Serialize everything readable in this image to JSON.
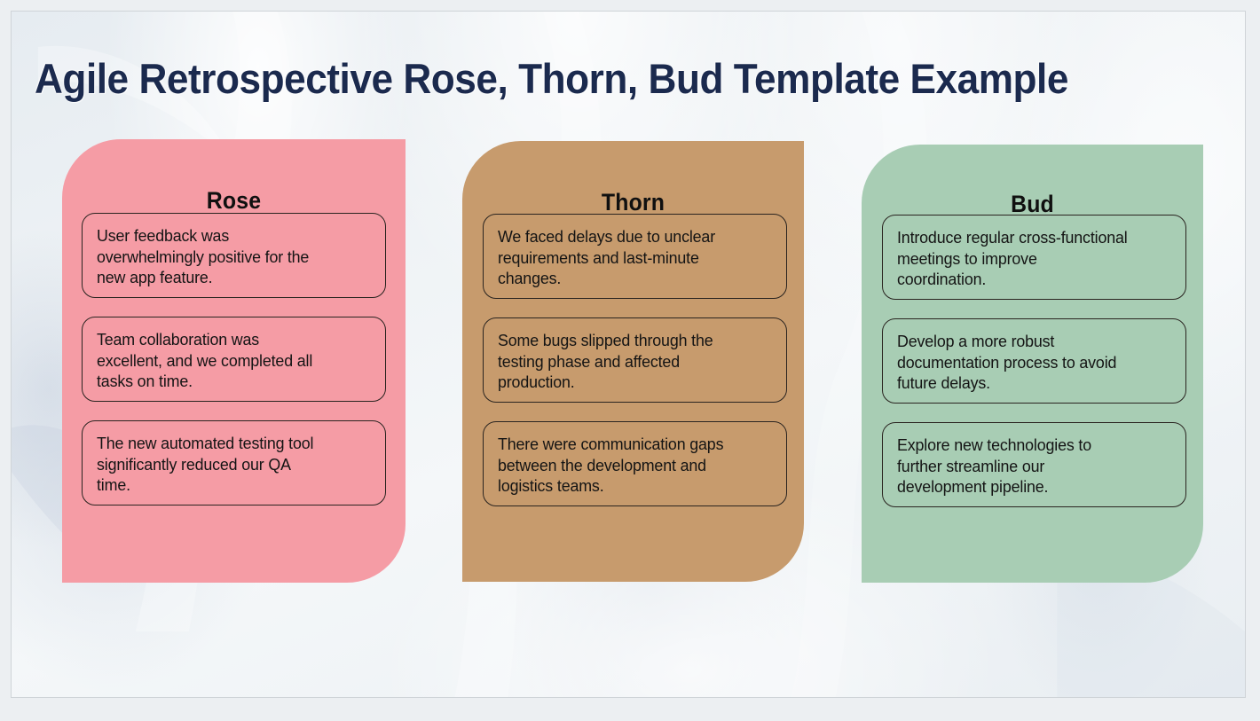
{
  "slide": {
    "title": "Agile Retrospective Rose, Thorn, Bud Template Example",
    "title_color": "#1b2a4e",
    "background_color": "#eaeff3"
  },
  "columns": [
    {
      "key": "rose",
      "title": "Rose",
      "panel_color": "#f59ca5",
      "card_border_color": "#2a2420",
      "cards": [
        {
          "text": "User feedback was\noverwhelmingly positive for the\nnew app feature."
        },
        {
          "text": "Team collaboration was\nexcellent, and we completed all\ntasks on time."
        },
        {
          "text": "The new automated testing tool\nsignificantly reduced our QA\ntime."
        }
      ]
    },
    {
      "key": "thorn",
      "title": "Thorn",
      "panel_color": "#c79b6d",
      "card_border_color": "#2a2420",
      "cards": [
        {
          "text": "We faced delays due to unclear\nrequirements and last-minute\nchanges."
        },
        {
          "text": "Some bugs slipped through the\ntesting phase and affected\nproduction."
        },
        {
          "text": "There were communication gaps\nbetween the development and\nlogistics teams."
        }
      ]
    },
    {
      "key": "bud",
      "title": "Bud",
      "panel_color": "#a8cdb4",
      "card_border_color": "#2a2420",
      "cards": [
        {
          "text": "Introduce regular cross-functional\nmeetings to improve\ncoordination."
        },
        {
          "text": "Develop a more robust\ndocumentation process to avoid\nfuture delays."
        },
        {
          "text": "Explore new technologies to\nfurther streamline our\ndevelopment pipeline."
        }
      ]
    }
  ]
}
